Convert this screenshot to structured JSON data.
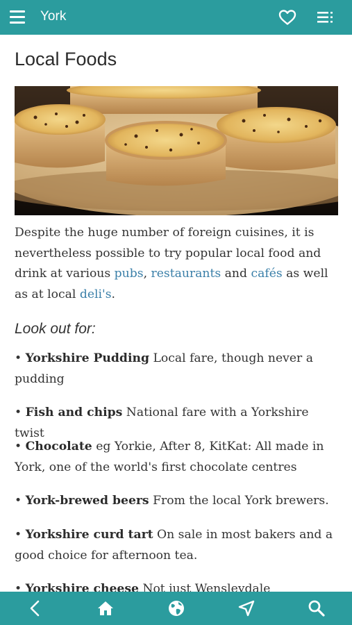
{
  "topbar": {
    "title": "York"
  },
  "page": {
    "title": "Local Foods",
    "intro": {
      "part1": "Despite the huge number of foreign cuisines, it is nevertheless possible to try popular local food and drink at various ",
      "link_pubs": "pubs",
      "sep1": ", ",
      "link_restaurants": "restaurants",
      "sep2": " and ",
      "link_cafes": "cafés",
      "part2": " as well as at local ",
      "link_delis": "deli's",
      "part3": "."
    },
    "subheading": "Look out for:",
    "items": [
      {
        "name": "Yorkshire Pudding",
        "desc": "Local fare, though never a pudding"
      },
      {
        "name": "Fish and chips",
        "desc": "National fare with a Yorkshire twist"
      },
      {
        "name": "Chocolate",
        "desc": "eg Yorkie, After 8, KitKat: All made in York, one of the world's first chocolate centres"
      },
      {
        "name": "York-brewed beers",
        "desc": "From the local York brewers."
      },
      {
        "name": "Yorkshire curd tart",
        "desc": "On sale in most bakers and a good choice for afternoon tea."
      },
      {
        "name": "Yorkshire cheese",
        "desc": "Not just Wensleydale"
      }
    ],
    "bullet": "• "
  },
  "icons": {
    "menu": "menu-icon",
    "favorite": "heart-icon",
    "toc": "table-of-contents-icon",
    "back": "chevron-left-icon",
    "home": "home-icon",
    "globe": "globe-icon",
    "navigate": "navigation-arrow-icon",
    "search": "search-icon"
  },
  "colors": {
    "bar": "#2b9c9e",
    "link": "#3a7fa8",
    "text": "#333333"
  }
}
